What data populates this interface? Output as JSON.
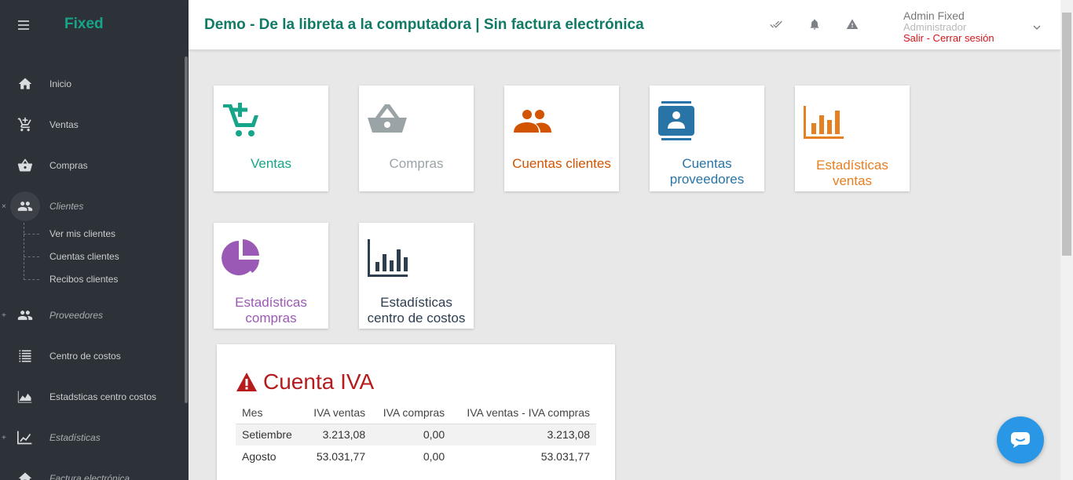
{
  "brand": "Fixed",
  "header": {
    "title": "Demo - De la libreta a la computadora | Sin factura electrónica",
    "user_name": "Admin Fixed",
    "user_role": "Administrador",
    "logout": "Salir - Cerrar sesión"
  },
  "sidebar": {
    "items": [
      {
        "label": "Inicio",
        "icon": "home-icon"
      },
      {
        "label": "Ventas",
        "icon": "cart-plus-icon"
      },
      {
        "label": "Compras",
        "icon": "basket-icon"
      },
      {
        "label": "Clientes",
        "icon": "people-icon",
        "expander": "×"
      },
      {
        "label": "Proveedores",
        "icon": "people-icon",
        "expander": "+"
      },
      {
        "label": "Centro de costos",
        "icon": "list-icon"
      },
      {
        "label": "Estadsticas centro costos",
        "icon": "area-chart-icon"
      },
      {
        "label": "Estadísticas",
        "icon": "line-chart-icon",
        "expander": "+"
      },
      {
        "label": "Factura electrónica",
        "icon": "home-icon"
      }
    ],
    "subitems": [
      "Ver mis clientes",
      "Cuentas clientes",
      "Recibos clientes"
    ]
  },
  "tiles": [
    {
      "label1": "Ventas",
      "label2": "",
      "color": "#17a589",
      "icon": "cart-plus-icon"
    },
    {
      "label1": "Compras",
      "label2": "",
      "color": "#9aa3a6",
      "icon": "basket-icon"
    },
    {
      "label1": "Cuentas clientes",
      "label2": "",
      "color": "#d35400",
      "icon": "people-icon"
    },
    {
      "label1": "Cuentas",
      "label2": "proveedores",
      "color": "#2874a6",
      "icon": "contact-card-icon"
    },
    {
      "label1": "Estadísticas",
      "label2": "ventas",
      "color": "#e67e22",
      "icon": "bar-chart-icon"
    },
    {
      "label1": "Estadísticas",
      "label2": "compras",
      "color": "#9b59b6",
      "icon": "pie-chart-icon"
    },
    {
      "label1": "Estadísticas",
      "label2": "centro de costos",
      "color": "#2c3e50",
      "icon": "bar-chart-icon"
    }
  ],
  "iva": {
    "title": "Cuenta IVA",
    "columns": [
      "Mes",
      "IVA ventas",
      "IVA compras",
      "IVA ventas - IVA compras"
    ],
    "rows": [
      [
        "Setiembre",
        "3.213,08",
        "0,00",
        "3.213,08"
      ],
      [
        "Agosto",
        "53.031,77",
        "0,00",
        "53.031,77"
      ]
    ]
  }
}
